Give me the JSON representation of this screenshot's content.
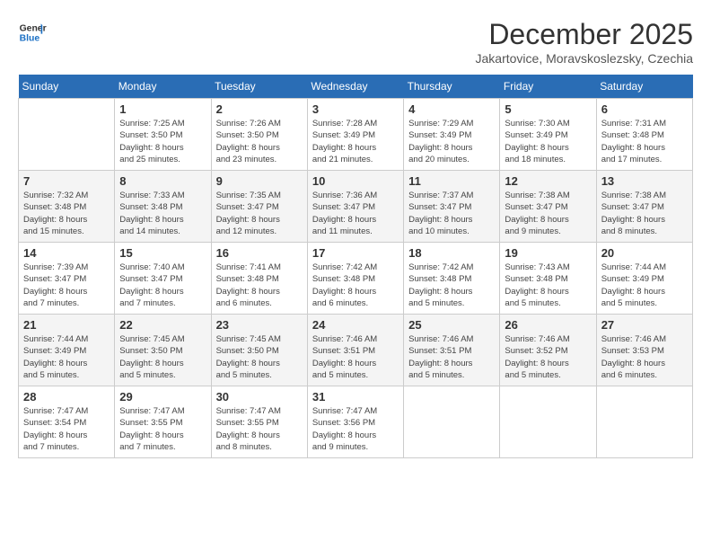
{
  "logo": {
    "line1": "General",
    "line2": "Blue"
  },
  "title": "December 2025",
  "subtitle": "Jakartovice, Moravskoslezsky, Czechia",
  "days_of_week": [
    "Sunday",
    "Monday",
    "Tuesday",
    "Wednesday",
    "Thursday",
    "Friday",
    "Saturday"
  ],
  "weeks": [
    [
      {
        "day": "",
        "info": ""
      },
      {
        "day": "1",
        "info": "Sunrise: 7:25 AM\nSunset: 3:50 PM\nDaylight: 8 hours\nand 25 minutes."
      },
      {
        "day": "2",
        "info": "Sunrise: 7:26 AM\nSunset: 3:50 PM\nDaylight: 8 hours\nand 23 minutes."
      },
      {
        "day": "3",
        "info": "Sunrise: 7:28 AM\nSunset: 3:49 PM\nDaylight: 8 hours\nand 21 minutes."
      },
      {
        "day": "4",
        "info": "Sunrise: 7:29 AM\nSunset: 3:49 PM\nDaylight: 8 hours\nand 20 minutes."
      },
      {
        "day": "5",
        "info": "Sunrise: 7:30 AM\nSunset: 3:49 PM\nDaylight: 8 hours\nand 18 minutes."
      },
      {
        "day": "6",
        "info": "Sunrise: 7:31 AM\nSunset: 3:48 PM\nDaylight: 8 hours\nand 17 minutes."
      }
    ],
    [
      {
        "day": "7",
        "info": "Sunrise: 7:32 AM\nSunset: 3:48 PM\nDaylight: 8 hours\nand 15 minutes."
      },
      {
        "day": "8",
        "info": "Sunrise: 7:33 AM\nSunset: 3:48 PM\nDaylight: 8 hours\nand 14 minutes."
      },
      {
        "day": "9",
        "info": "Sunrise: 7:35 AM\nSunset: 3:47 PM\nDaylight: 8 hours\nand 12 minutes."
      },
      {
        "day": "10",
        "info": "Sunrise: 7:36 AM\nSunset: 3:47 PM\nDaylight: 8 hours\nand 11 minutes."
      },
      {
        "day": "11",
        "info": "Sunrise: 7:37 AM\nSunset: 3:47 PM\nDaylight: 8 hours\nand 10 minutes."
      },
      {
        "day": "12",
        "info": "Sunrise: 7:38 AM\nSunset: 3:47 PM\nDaylight: 8 hours\nand 9 minutes."
      },
      {
        "day": "13",
        "info": "Sunrise: 7:38 AM\nSunset: 3:47 PM\nDaylight: 8 hours\nand 8 minutes."
      }
    ],
    [
      {
        "day": "14",
        "info": "Sunrise: 7:39 AM\nSunset: 3:47 PM\nDaylight: 8 hours\nand 7 minutes."
      },
      {
        "day": "15",
        "info": "Sunrise: 7:40 AM\nSunset: 3:47 PM\nDaylight: 8 hours\nand 7 minutes."
      },
      {
        "day": "16",
        "info": "Sunrise: 7:41 AM\nSunset: 3:48 PM\nDaylight: 8 hours\nand 6 minutes."
      },
      {
        "day": "17",
        "info": "Sunrise: 7:42 AM\nSunset: 3:48 PM\nDaylight: 8 hours\nand 6 minutes."
      },
      {
        "day": "18",
        "info": "Sunrise: 7:42 AM\nSunset: 3:48 PM\nDaylight: 8 hours\nand 5 minutes."
      },
      {
        "day": "19",
        "info": "Sunrise: 7:43 AM\nSunset: 3:48 PM\nDaylight: 8 hours\nand 5 minutes."
      },
      {
        "day": "20",
        "info": "Sunrise: 7:44 AM\nSunset: 3:49 PM\nDaylight: 8 hours\nand 5 minutes."
      }
    ],
    [
      {
        "day": "21",
        "info": "Sunrise: 7:44 AM\nSunset: 3:49 PM\nDaylight: 8 hours\nand 5 minutes."
      },
      {
        "day": "22",
        "info": "Sunrise: 7:45 AM\nSunset: 3:50 PM\nDaylight: 8 hours\nand 5 minutes."
      },
      {
        "day": "23",
        "info": "Sunrise: 7:45 AM\nSunset: 3:50 PM\nDaylight: 8 hours\nand 5 minutes."
      },
      {
        "day": "24",
        "info": "Sunrise: 7:46 AM\nSunset: 3:51 PM\nDaylight: 8 hours\nand 5 minutes."
      },
      {
        "day": "25",
        "info": "Sunrise: 7:46 AM\nSunset: 3:51 PM\nDaylight: 8 hours\nand 5 minutes."
      },
      {
        "day": "26",
        "info": "Sunrise: 7:46 AM\nSunset: 3:52 PM\nDaylight: 8 hours\nand 5 minutes."
      },
      {
        "day": "27",
        "info": "Sunrise: 7:46 AM\nSunset: 3:53 PM\nDaylight: 8 hours\nand 6 minutes."
      }
    ],
    [
      {
        "day": "28",
        "info": "Sunrise: 7:47 AM\nSunset: 3:54 PM\nDaylight: 8 hours\nand 7 minutes."
      },
      {
        "day": "29",
        "info": "Sunrise: 7:47 AM\nSunset: 3:55 PM\nDaylight: 8 hours\nand 7 minutes."
      },
      {
        "day": "30",
        "info": "Sunrise: 7:47 AM\nSunset: 3:55 PM\nDaylight: 8 hours\nand 8 minutes."
      },
      {
        "day": "31",
        "info": "Sunrise: 7:47 AM\nSunset: 3:56 PM\nDaylight: 8 hours\nand 9 minutes."
      },
      {
        "day": "",
        "info": ""
      },
      {
        "day": "",
        "info": ""
      },
      {
        "day": "",
        "info": ""
      }
    ]
  ]
}
